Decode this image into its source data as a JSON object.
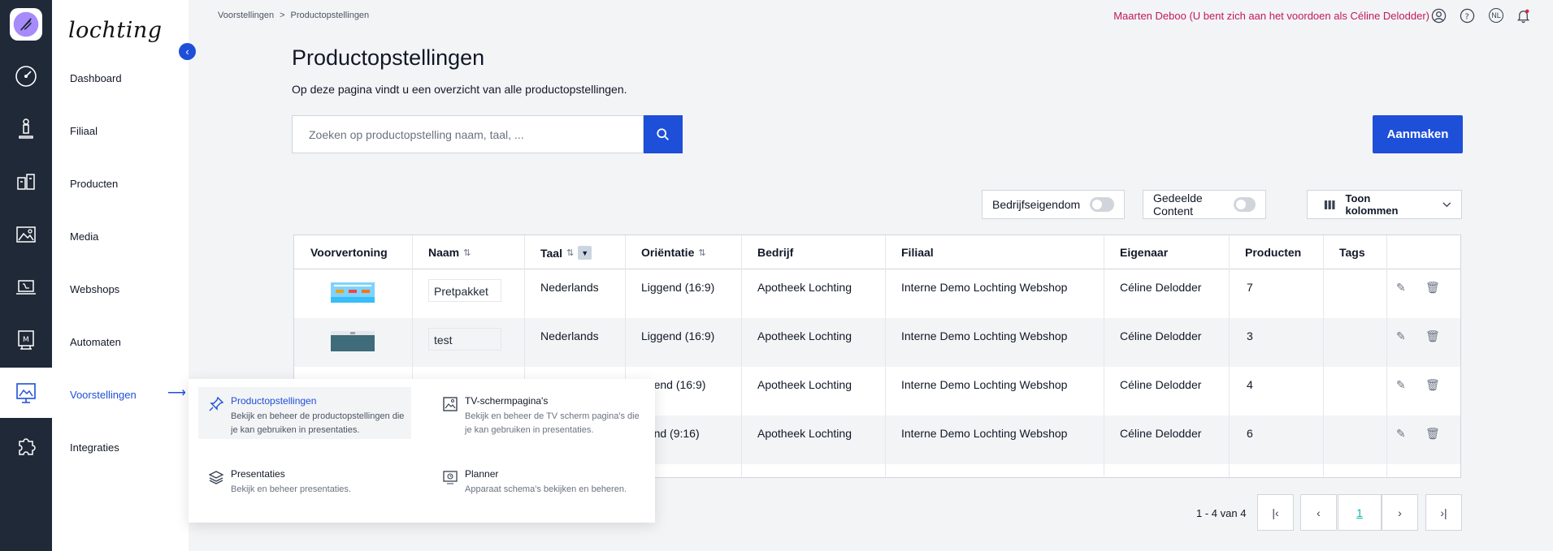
{
  "brand": "lochting",
  "nav": {
    "items": [
      {
        "label": "Dashboard"
      },
      {
        "label": "Filiaal"
      },
      {
        "label": "Producten"
      },
      {
        "label": "Media"
      },
      {
        "label": "Webshops"
      },
      {
        "label": "Automaten"
      },
      {
        "label": "Voorstellingen"
      },
      {
        "label": "Integraties"
      }
    ],
    "active_arrow": "⟶",
    "collapse_icon": "‹"
  },
  "breadcrumb": {
    "root": "Voorstellingen",
    "separator": ">",
    "current": "Productopstellingen"
  },
  "header": {
    "impersonation": "Maarten Deboo (U bent zich aan het voordoen als Céline Delodder)",
    "lang": "NL",
    "icons": [
      "user-circle-icon",
      "help-icon",
      "language-icon",
      "bell-icon"
    ]
  },
  "page": {
    "title": "Productopstellingen",
    "description": "Op deze pagina vindt u een overzicht van alle productopstellingen."
  },
  "search": {
    "placeholder": "Zoeken op productopstelling naam, taal, ..."
  },
  "create_button": "Aanmaken",
  "filters": {
    "bedrijfseigendom": "Bedrijfseigendom",
    "gedeelde_content": "Gedeelde Content",
    "toon_kolommen": "Toon kolommen"
  },
  "table": {
    "columns": [
      "Voorvertoning",
      "Naam",
      "Taal",
      "Oriëntatie",
      "Bedrijf",
      "Filiaal",
      "Eigenaar",
      "Producten",
      "Tags"
    ],
    "rows": [
      {
        "naam": "Pretpakket",
        "taal": "Nederlands",
        "orientatie": "Liggend (16:9)",
        "bedrijf": "Apotheek Lochting",
        "filiaal": "Interne Demo Lochting Webshop",
        "eigenaar": "Céline Delodder",
        "producten": "7"
      },
      {
        "naam": "test",
        "taal": "Nederlands",
        "orientatie": "Liggend (16:9)",
        "bedrijf": "Apotheek Lochting",
        "filiaal": "Interne Demo Lochting Webshop",
        "eigenaar": "Céline Delodder",
        "producten": "3"
      },
      {
        "naam": "",
        "taal": "",
        "orientatie": "ggend (16:9)",
        "bedrijf": "Apotheek Lochting",
        "filiaal": "Interne Demo Lochting Webshop",
        "eigenaar": "Céline Delodder",
        "producten": "4"
      },
      {
        "naam": "",
        "taal": "",
        "orientatie": "aand (9:16)",
        "bedrijf": "Apotheek Lochting",
        "filiaal": "Interne Demo Lochting Webshop",
        "eigenaar": "Céline Delodder",
        "producten": "6"
      }
    ]
  },
  "pagination": {
    "summary": "1 - 4 van 4",
    "current_page": "1",
    "first": "|‹",
    "prev": "‹",
    "next": "›",
    "last": "›|"
  },
  "flyout": {
    "items": [
      {
        "title": "Productopstellingen",
        "desc": "Bekijk en beheer de productopstellingen die je kan gebruiken in presentaties."
      },
      {
        "title": "TV-schermpagina's",
        "desc": "Bekijk en beheer de TV scherm pagina's die je kan gebruiken in presentaties."
      },
      {
        "title": "Presentaties",
        "desc": "Bekijk en beheer presentaties."
      },
      {
        "title": "Planner",
        "desc": "Apparaat schema's bekijken en beheren."
      }
    ]
  },
  "colors": {
    "accent": "#1e4fd8",
    "impersonation": "#c2185b",
    "rail": "#1f2937"
  }
}
